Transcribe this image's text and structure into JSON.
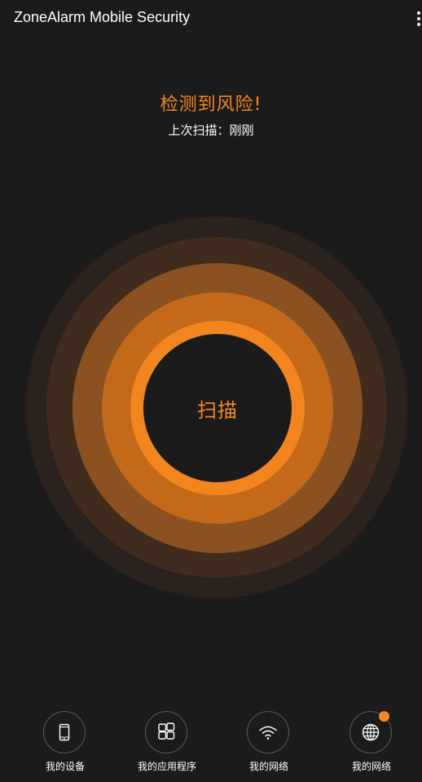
{
  "app": {
    "title": "ZoneAlarm Mobile Security"
  },
  "status": {
    "title": "检测到风险!",
    "last_scan": "上次扫描：刚刚"
  },
  "scan": {
    "label": "扫描"
  },
  "colors": {
    "accent": "#f5871f",
    "background": "#1b1b1c"
  },
  "nav": {
    "items": [
      {
        "label": "我的设备",
        "icon": "phone-icon"
      },
      {
        "label": "我的应用程序",
        "icon": "apps-grid-icon"
      },
      {
        "label": "我的网络",
        "icon": "wifi-icon"
      },
      {
        "label": "我的网络",
        "icon": "globe-icon",
        "badge": true
      }
    ]
  }
}
